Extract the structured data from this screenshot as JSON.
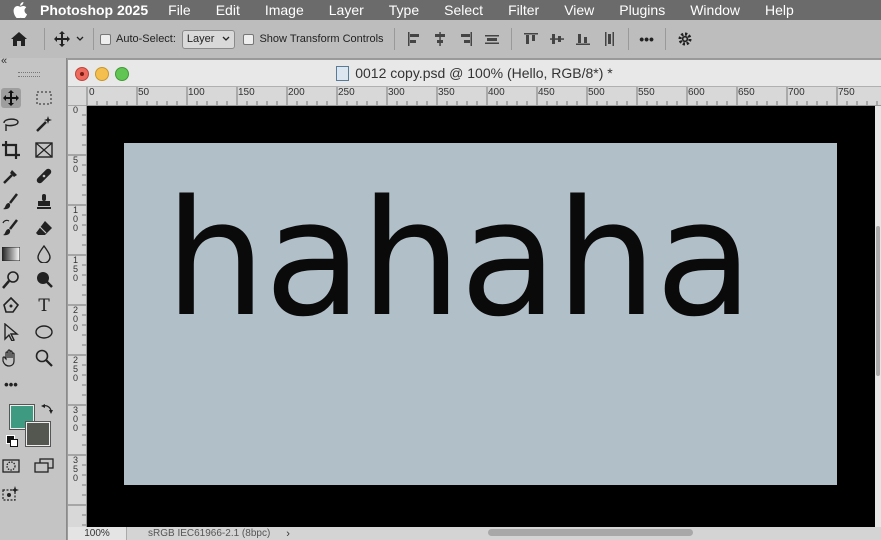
{
  "menubar": {
    "app_name": "Photoshop 2025",
    "items": [
      "File",
      "Edit",
      "Image",
      "Layer",
      "Type",
      "Select",
      "Filter",
      "View",
      "Plugins",
      "Window",
      "Help"
    ]
  },
  "options_bar": {
    "auto_select_label": "Auto-Select:",
    "auto_select_value": "Layer",
    "show_transform_label": "Show Transform Controls",
    "more_label": "•••"
  },
  "document": {
    "title": "0012 copy.psd @ 100% (Hello, RGB/8*) *",
    "canvas_text": "hahaha",
    "zoom": "100%",
    "color_profile": "sRGB IEC61966-2.1 (8bpc)",
    "status_arrow": "›"
  },
  "rulers": {
    "horizontal": [
      "0",
      "50",
      "100",
      "150",
      "200",
      "250",
      "300",
      "350",
      "400",
      "450",
      "500",
      "550",
      "600",
      "650",
      "700",
      "750"
    ],
    "vertical": [
      "0",
      "5\n0",
      "1\n0\n0",
      "1\n5\n0",
      "2\n0\n0",
      "2\n5\n0",
      "3\n0\n0",
      "3\n5\n0"
    ]
  },
  "colors": {
    "foreground": "#3f9a82",
    "background": "#545650",
    "canvas_fill": "#b1bfc8",
    "border_fill": "#000000"
  },
  "tools_panel": {
    "more_label": "•••",
    "text_tool_label": "T",
    "collapse_label": "«"
  }
}
